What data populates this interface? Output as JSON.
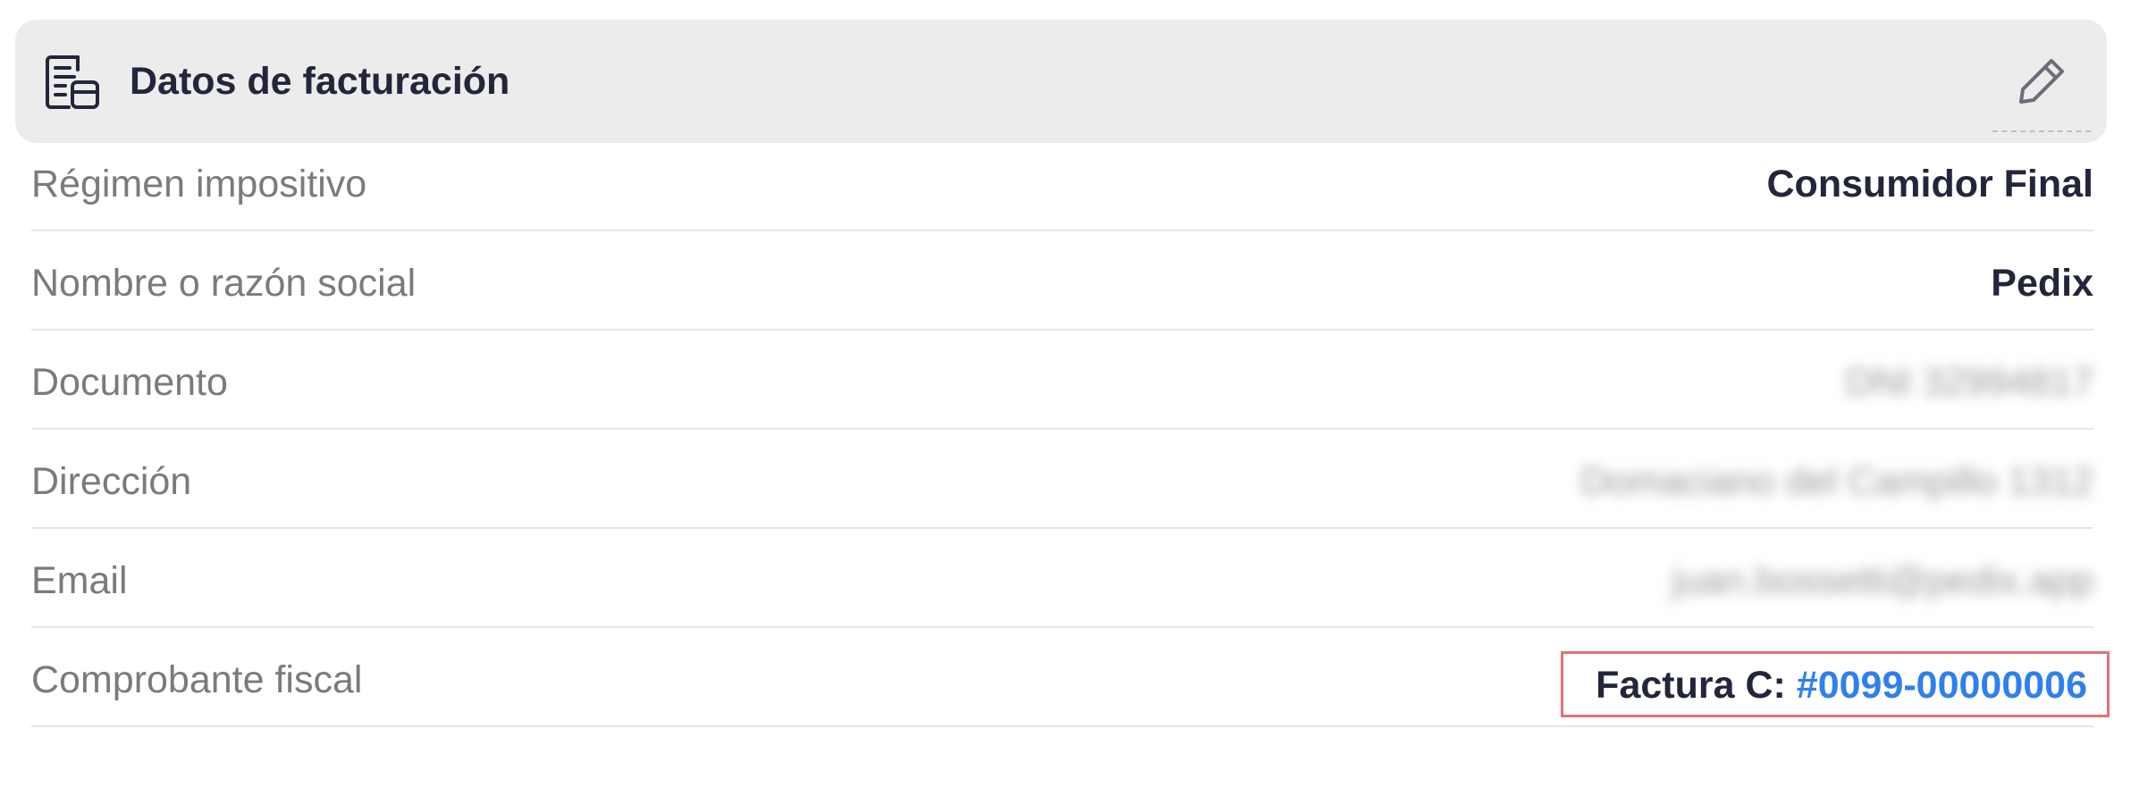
{
  "header": {
    "title": "Datos de facturación",
    "icon": "billing-document-icon",
    "edit_icon": "pencil-icon"
  },
  "rows": [
    {
      "label": "Régimen impositivo",
      "value": "Consumidor Final"
    },
    {
      "label": "Nombre o razón social",
      "value": "Pedix"
    },
    {
      "label": "Documento",
      "value": "DNI 32994817"
    },
    {
      "label": "Dirección",
      "value": "Domaciano del Campillo 1312"
    },
    {
      "label": "Email",
      "value": "juan.bossetti@pedix.app"
    },
    {
      "label": "Comprobante fiscal",
      "value_prefix": "Factura C:",
      "value_link": "#0099-00000006"
    }
  ],
  "colors": {
    "link": "#2f7ff0",
    "highlight_border": "#e0737a",
    "header_bg": "#ececec",
    "label": "#7b7b7b",
    "value": "#23263b"
  }
}
